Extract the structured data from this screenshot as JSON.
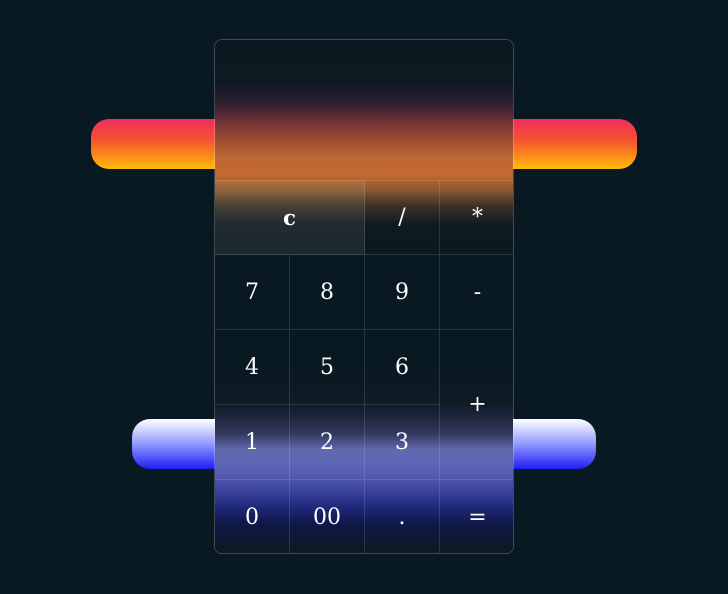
{
  "calculator": {
    "display_value": "",
    "keys": {
      "clear": "c",
      "divide": "/",
      "multiply": "*",
      "seven": "7",
      "eight": "8",
      "nine": "9",
      "minus": "-",
      "four": "4",
      "five": "5",
      "six": "6",
      "plus": "+",
      "one": "1",
      "two": "2",
      "three": "3",
      "zero": "0",
      "double_zero": "00",
      "decimal": ".",
      "equals": "="
    }
  },
  "colors": {
    "background": "#091921",
    "top_pill_gradient": [
      "#f02c5b",
      "#ffbb08"
    ],
    "bottom_pill_gradient": [
      "#ffffff",
      "#1f1ff4"
    ],
    "key_text": "#ffffff"
  }
}
